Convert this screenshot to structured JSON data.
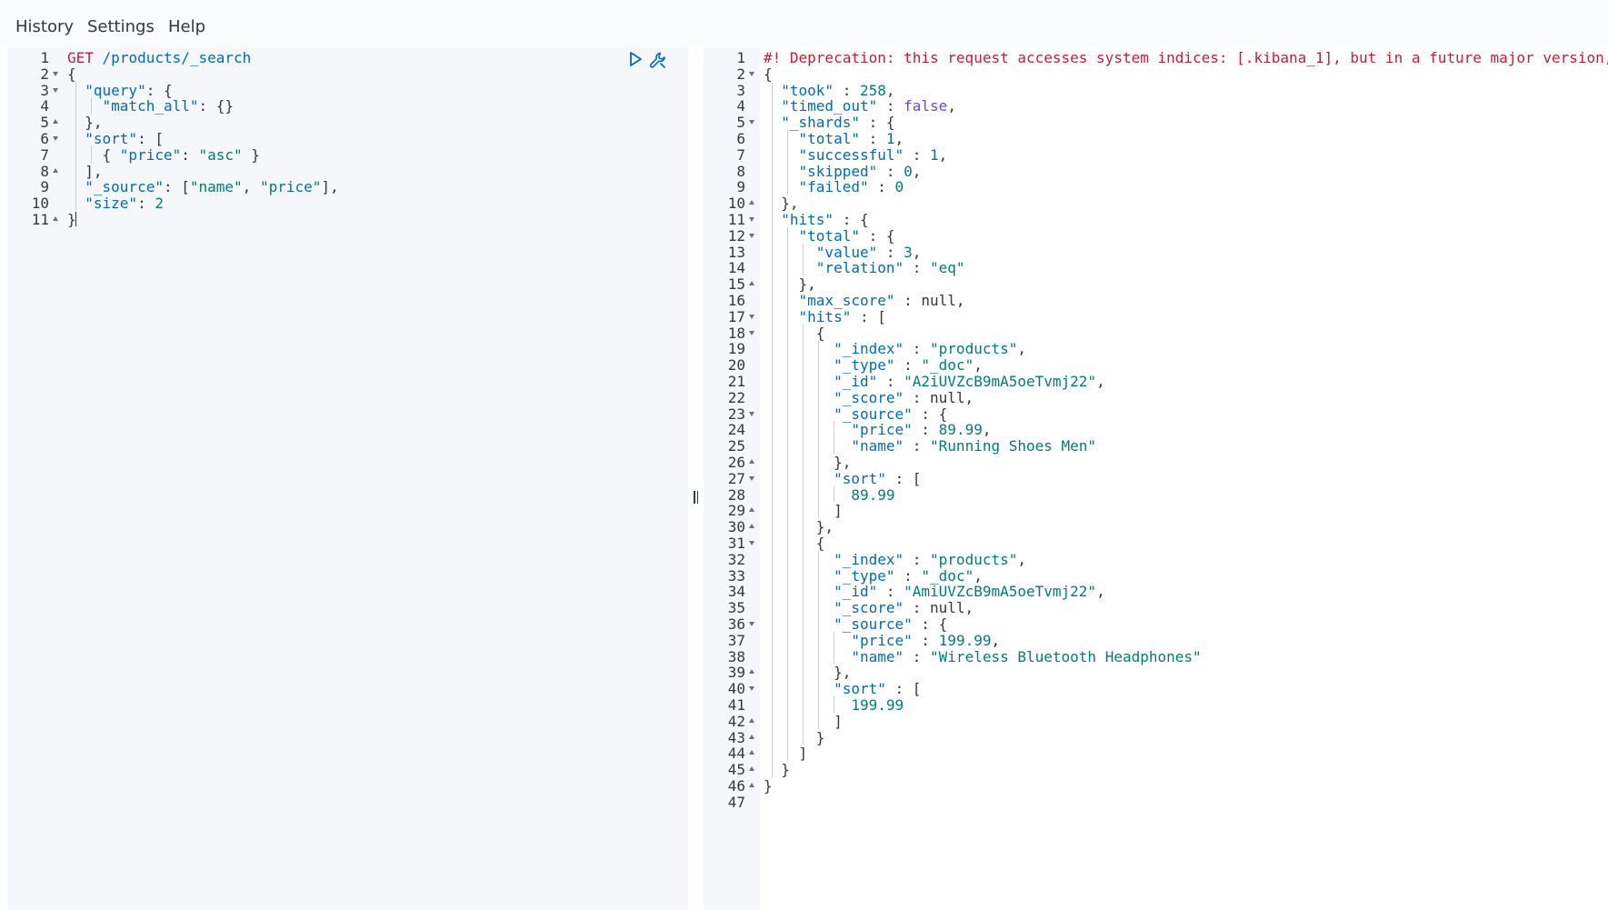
{
  "menu": {
    "history": "History",
    "settings": "Settings",
    "help": "Help"
  },
  "request": {
    "run_button_icon": "play-icon",
    "settings_button_icon": "wrench-icon",
    "active_line": 11,
    "lines": [
      {
        "n": "1",
        "fold": "",
        "tokens": [
          {
            "t": "GET",
            "c": "method"
          },
          {
            "t": " ",
            "c": "punc"
          },
          {
            "t": "/products/_search",
            "c": "url"
          }
        ]
      },
      {
        "n": "2",
        "fold": "open",
        "tokens": [
          {
            "t": "{",
            "c": "punc"
          }
        ]
      },
      {
        "n": "3",
        "fold": "open",
        "tokens": [
          {
            "t": "  ",
            "c": "punc"
          },
          {
            "t": "\"query\"",
            "c": "key"
          },
          {
            "t": ": {",
            "c": "punc"
          }
        ]
      },
      {
        "n": "4",
        "fold": "",
        "tokens": [
          {
            "t": "    ",
            "c": "punc"
          },
          {
            "t": "\"match_all\"",
            "c": "key"
          },
          {
            "t": ": {}",
            "c": "punc"
          }
        ]
      },
      {
        "n": "5",
        "fold": "close",
        "tokens": [
          {
            "t": "  },",
            "c": "punc"
          }
        ]
      },
      {
        "n": "6",
        "fold": "open",
        "tokens": [
          {
            "t": "  ",
            "c": "punc"
          },
          {
            "t": "\"sort\"",
            "c": "key"
          },
          {
            "t": ": [",
            "c": "punc"
          }
        ]
      },
      {
        "n": "7",
        "fold": "",
        "tokens": [
          {
            "t": "    { ",
            "c": "punc"
          },
          {
            "t": "\"price\"",
            "c": "key"
          },
          {
            "t": ": ",
            "c": "punc"
          },
          {
            "t": "\"asc\"",
            "c": "str"
          },
          {
            "t": " }",
            "c": "punc"
          }
        ]
      },
      {
        "n": "8",
        "fold": "close",
        "tokens": [
          {
            "t": "  ],",
            "c": "punc"
          }
        ]
      },
      {
        "n": "9",
        "fold": "",
        "tokens": [
          {
            "t": "  ",
            "c": "punc"
          },
          {
            "t": "\"_source\"",
            "c": "key"
          },
          {
            "t": ": [",
            "c": "punc"
          },
          {
            "t": "\"name\"",
            "c": "str"
          },
          {
            "t": ", ",
            "c": "punc"
          },
          {
            "t": "\"price\"",
            "c": "str"
          },
          {
            "t": "],",
            "c": "punc"
          }
        ]
      },
      {
        "n": "10",
        "fold": "",
        "tokens": [
          {
            "t": "  ",
            "c": "punc"
          },
          {
            "t": "\"size\"",
            "c": "key"
          },
          {
            "t": ": ",
            "c": "punc"
          },
          {
            "t": "2",
            "c": "num"
          }
        ]
      },
      {
        "n": "11",
        "fold": "close",
        "tokens": [
          {
            "t": "}",
            "c": "punc"
          }
        ]
      }
    ]
  },
  "response": {
    "lines": [
      {
        "n": "1",
        "fold": "",
        "tokens": [
          {
            "t": "#! Deprecation: this request accesses system indices: [.kibana_1], but in a future major version,",
            "c": "comment"
          }
        ]
      },
      {
        "n": "2",
        "fold": "open",
        "tokens": [
          {
            "t": "{",
            "c": "punc"
          }
        ]
      },
      {
        "n": "3",
        "fold": "",
        "tokens": [
          {
            "t": "  ",
            "c": "punc"
          },
          {
            "t": "\"took\"",
            "c": "key"
          },
          {
            "t": " : ",
            "c": "punc"
          },
          {
            "t": "258",
            "c": "num"
          },
          {
            "t": ",",
            "c": "punc"
          }
        ]
      },
      {
        "n": "4",
        "fold": "",
        "tokens": [
          {
            "t": "  ",
            "c": "punc"
          },
          {
            "t": "\"timed_out\"",
            "c": "key"
          },
          {
            "t": " : ",
            "c": "punc"
          },
          {
            "t": "false",
            "c": "bool"
          },
          {
            "t": ",",
            "c": "punc"
          }
        ]
      },
      {
        "n": "5",
        "fold": "open",
        "tokens": [
          {
            "t": "  ",
            "c": "punc"
          },
          {
            "t": "\"_shards\"",
            "c": "key"
          },
          {
            "t": " : {",
            "c": "punc"
          }
        ]
      },
      {
        "n": "6",
        "fold": "",
        "tokens": [
          {
            "t": "    ",
            "c": "punc"
          },
          {
            "t": "\"total\"",
            "c": "key"
          },
          {
            "t": " : ",
            "c": "punc"
          },
          {
            "t": "1",
            "c": "num"
          },
          {
            "t": ",",
            "c": "punc"
          }
        ]
      },
      {
        "n": "7",
        "fold": "",
        "tokens": [
          {
            "t": "    ",
            "c": "punc"
          },
          {
            "t": "\"successful\"",
            "c": "key"
          },
          {
            "t": " : ",
            "c": "punc"
          },
          {
            "t": "1",
            "c": "num"
          },
          {
            "t": ",",
            "c": "punc"
          }
        ]
      },
      {
        "n": "8",
        "fold": "",
        "tokens": [
          {
            "t": "    ",
            "c": "punc"
          },
          {
            "t": "\"skipped\"",
            "c": "key"
          },
          {
            "t": " : ",
            "c": "punc"
          },
          {
            "t": "0",
            "c": "num"
          },
          {
            "t": ",",
            "c": "punc"
          }
        ]
      },
      {
        "n": "9",
        "fold": "",
        "tokens": [
          {
            "t": "    ",
            "c": "punc"
          },
          {
            "t": "\"failed\"",
            "c": "key"
          },
          {
            "t": " : ",
            "c": "punc"
          },
          {
            "t": "0",
            "c": "num"
          }
        ]
      },
      {
        "n": "10",
        "fold": "close",
        "tokens": [
          {
            "t": "  },",
            "c": "punc"
          }
        ]
      },
      {
        "n": "11",
        "fold": "open",
        "tokens": [
          {
            "t": "  ",
            "c": "punc"
          },
          {
            "t": "\"hits\"",
            "c": "key"
          },
          {
            "t": " : {",
            "c": "punc"
          }
        ]
      },
      {
        "n": "12",
        "fold": "open",
        "tokens": [
          {
            "t": "    ",
            "c": "punc"
          },
          {
            "t": "\"total\"",
            "c": "key"
          },
          {
            "t": " : {",
            "c": "punc"
          }
        ]
      },
      {
        "n": "13",
        "fold": "",
        "tokens": [
          {
            "t": "      ",
            "c": "punc"
          },
          {
            "t": "\"value\"",
            "c": "key"
          },
          {
            "t": " : ",
            "c": "punc"
          },
          {
            "t": "3",
            "c": "num"
          },
          {
            "t": ",",
            "c": "punc"
          }
        ]
      },
      {
        "n": "14",
        "fold": "",
        "tokens": [
          {
            "t": "      ",
            "c": "punc"
          },
          {
            "t": "\"relation\"",
            "c": "key"
          },
          {
            "t": " : ",
            "c": "punc"
          },
          {
            "t": "\"eq\"",
            "c": "str"
          }
        ]
      },
      {
        "n": "15",
        "fold": "close",
        "tokens": [
          {
            "t": "    },",
            "c": "punc"
          }
        ]
      },
      {
        "n": "16",
        "fold": "",
        "tokens": [
          {
            "t": "    ",
            "c": "punc"
          },
          {
            "t": "\"max_score\"",
            "c": "key"
          },
          {
            "t": " : null,",
            "c": "null"
          }
        ]
      },
      {
        "n": "17",
        "fold": "open",
        "tokens": [
          {
            "t": "    ",
            "c": "punc"
          },
          {
            "t": "\"hits\"",
            "c": "key"
          },
          {
            "t": " : [",
            "c": "punc"
          }
        ]
      },
      {
        "n": "18",
        "fold": "open",
        "tokens": [
          {
            "t": "      {",
            "c": "punc"
          }
        ]
      },
      {
        "n": "19",
        "fold": "",
        "tokens": [
          {
            "t": "        ",
            "c": "punc"
          },
          {
            "t": "\"_index\"",
            "c": "key"
          },
          {
            "t": " : ",
            "c": "punc"
          },
          {
            "t": "\"products\"",
            "c": "str"
          },
          {
            "t": ",",
            "c": "punc"
          }
        ]
      },
      {
        "n": "20",
        "fold": "",
        "tokens": [
          {
            "t": "        ",
            "c": "punc"
          },
          {
            "t": "\"_type\"",
            "c": "key"
          },
          {
            "t": " : ",
            "c": "punc"
          },
          {
            "t": "\"_doc\"",
            "c": "str"
          },
          {
            "t": ",",
            "c": "punc"
          }
        ]
      },
      {
        "n": "21",
        "fold": "",
        "tokens": [
          {
            "t": "        ",
            "c": "punc"
          },
          {
            "t": "\"_id\"",
            "c": "key"
          },
          {
            "t": " : ",
            "c": "punc"
          },
          {
            "t": "\"A2iUVZcB9mA5oeTvmj22\"",
            "c": "str"
          },
          {
            "t": ",",
            "c": "punc"
          }
        ]
      },
      {
        "n": "22",
        "fold": "",
        "tokens": [
          {
            "t": "        ",
            "c": "punc"
          },
          {
            "t": "\"_score\"",
            "c": "key"
          },
          {
            "t": " : null,",
            "c": "null"
          }
        ]
      },
      {
        "n": "23",
        "fold": "open",
        "tokens": [
          {
            "t": "        ",
            "c": "punc"
          },
          {
            "t": "\"_source\"",
            "c": "key"
          },
          {
            "t": " : {",
            "c": "punc"
          }
        ]
      },
      {
        "n": "24",
        "fold": "",
        "tokens": [
          {
            "t": "          ",
            "c": "punc"
          },
          {
            "t": "\"price\"",
            "c": "key"
          },
          {
            "t": " : ",
            "c": "punc"
          },
          {
            "t": "89.99",
            "c": "num"
          },
          {
            "t": ",",
            "c": "punc"
          }
        ]
      },
      {
        "n": "25",
        "fold": "",
        "tokens": [
          {
            "t": "          ",
            "c": "punc"
          },
          {
            "t": "\"name\"",
            "c": "key"
          },
          {
            "t": " : ",
            "c": "punc"
          },
          {
            "t": "\"Running Shoes Men\"",
            "c": "str"
          }
        ]
      },
      {
        "n": "26",
        "fold": "close",
        "tokens": [
          {
            "t": "        },",
            "c": "punc"
          }
        ]
      },
      {
        "n": "27",
        "fold": "open",
        "tokens": [
          {
            "t": "        ",
            "c": "punc"
          },
          {
            "t": "\"sort\"",
            "c": "key"
          },
          {
            "t": " : [",
            "c": "punc"
          }
        ]
      },
      {
        "n": "28",
        "fold": "",
        "tokens": [
          {
            "t": "          ",
            "c": "punc"
          },
          {
            "t": "89.99",
            "c": "num"
          }
        ]
      },
      {
        "n": "29",
        "fold": "close",
        "tokens": [
          {
            "t": "        ]",
            "c": "punc"
          }
        ]
      },
      {
        "n": "30",
        "fold": "close",
        "tokens": [
          {
            "t": "      },",
            "c": "punc"
          }
        ]
      },
      {
        "n": "31",
        "fold": "open",
        "tokens": [
          {
            "t": "      {",
            "c": "punc"
          }
        ]
      },
      {
        "n": "32",
        "fold": "",
        "tokens": [
          {
            "t": "        ",
            "c": "punc"
          },
          {
            "t": "\"_index\"",
            "c": "key"
          },
          {
            "t": " : ",
            "c": "punc"
          },
          {
            "t": "\"products\"",
            "c": "str"
          },
          {
            "t": ",",
            "c": "punc"
          }
        ]
      },
      {
        "n": "33",
        "fold": "",
        "tokens": [
          {
            "t": "        ",
            "c": "punc"
          },
          {
            "t": "\"_type\"",
            "c": "key"
          },
          {
            "t": " : ",
            "c": "punc"
          },
          {
            "t": "\"_doc\"",
            "c": "str"
          },
          {
            "t": ",",
            "c": "punc"
          }
        ]
      },
      {
        "n": "34",
        "fold": "",
        "tokens": [
          {
            "t": "        ",
            "c": "punc"
          },
          {
            "t": "\"_id\"",
            "c": "key"
          },
          {
            "t": " : ",
            "c": "punc"
          },
          {
            "t": "\"AmiUVZcB9mA5oeTvmj22\"",
            "c": "str"
          },
          {
            "t": ",",
            "c": "punc"
          }
        ]
      },
      {
        "n": "35",
        "fold": "",
        "tokens": [
          {
            "t": "        ",
            "c": "punc"
          },
          {
            "t": "\"_score\"",
            "c": "key"
          },
          {
            "t": " : null,",
            "c": "null"
          }
        ]
      },
      {
        "n": "36",
        "fold": "open",
        "tokens": [
          {
            "t": "        ",
            "c": "punc"
          },
          {
            "t": "\"_source\"",
            "c": "key"
          },
          {
            "t": " : {",
            "c": "punc"
          }
        ]
      },
      {
        "n": "37",
        "fold": "",
        "tokens": [
          {
            "t": "          ",
            "c": "punc"
          },
          {
            "t": "\"price\"",
            "c": "key"
          },
          {
            "t": " : ",
            "c": "punc"
          },
          {
            "t": "199.99",
            "c": "num"
          },
          {
            "t": ",",
            "c": "punc"
          }
        ]
      },
      {
        "n": "38",
        "fold": "",
        "tokens": [
          {
            "t": "          ",
            "c": "punc"
          },
          {
            "t": "\"name\"",
            "c": "key"
          },
          {
            "t": " : ",
            "c": "punc"
          },
          {
            "t": "\"Wireless Bluetooth Headphones\"",
            "c": "str"
          }
        ]
      },
      {
        "n": "39",
        "fold": "close",
        "tokens": [
          {
            "t": "        },",
            "c": "punc"
          }
        ]
      },
      {
        "n": "40",
        "fold": "open",
        "tokens": [
          {
            "t": "        ",
            "c": "punc"
          },
          {
            "t": "\"sort\"",
            "c": "key"
          },
          {
            "t": " : [",
            "c": "punc"
          }
        ]
      },
      {
        "n": "41",
        "fold": "",
        "tokens": [
          {
            "t": "          ",
            "c": "punc"
          },
          {
            "t": "199.99",
            "c": "num"
          }
        ]
      },
      {
        "n": "42",
        "fold": "close",
        "tokens": [
          {
            "t": "        ]",
            "c": "punc"
          }
        ]
      },
      {
        "n": "43",
        "fold": "close",
        "tokens": [
          {
            "t": "      }",
            "c": "punc"
          }
        ]
      },
      {
        "n": "44",
        "fold": "close",
        "tokens": [
          {
            "t": "    ]",
            "c": "punc"
          }
        ]
      },
      {
        "n": "45",
        "fold": "close",
        "tokens": [
          {
            "t": "  }",
            "c": "punc"
          }
        ]
      },
      {
        "n": "46",
        "fold": "close",
        "tokens": [
          {
            "t": "}",
            "c": "punc"
          }
        ]
      },
      {
        "n": "47",
        "fold": "",
        "tokens": []
      }
    ]
  },
  "colors": {
    "method": "#c41e3a",
    "key": "#006bb8",
    "string": "#017d73",
    "boolean": "#6b45e8",
    "comment": "#c41e3a",
    "editor_bg": "#f5f7fa",
    "active_line_bg": "#e6e9ef"
  }
}
